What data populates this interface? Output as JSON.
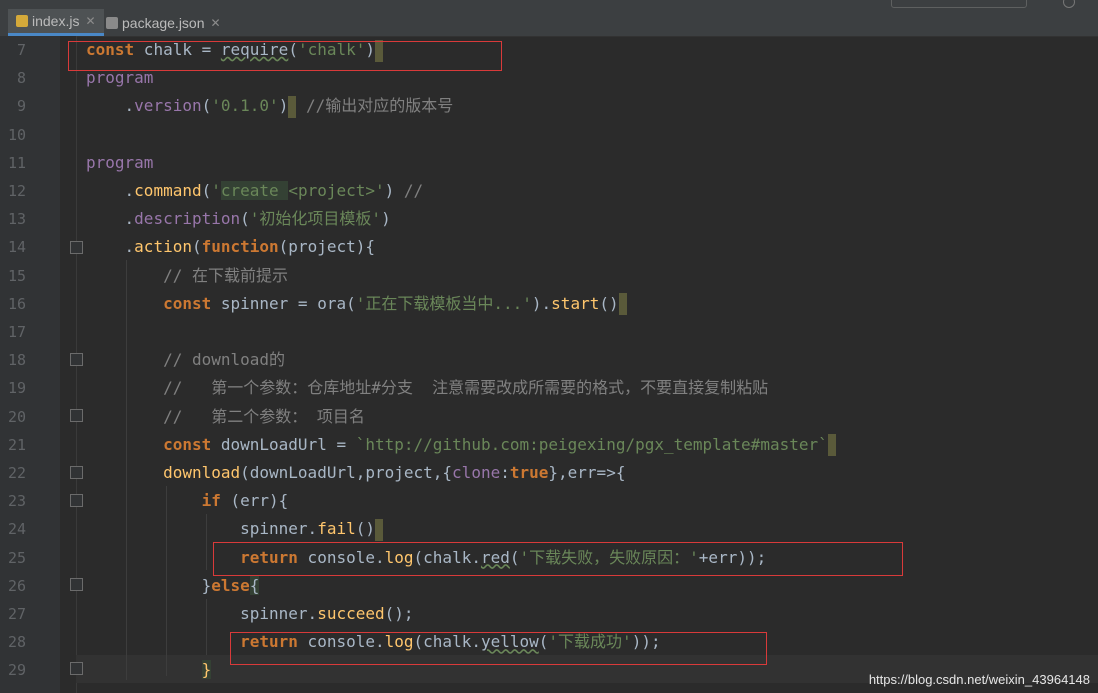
{
  "tabs": [
    {
      "label": "index.js",
      "active": true
    },
    {
      "label": "package.json",
      "active": false
    }
  ],
  "lines": [
    {
      "n": "7",
      "html": "<span class=\"kw\">const</span> chalk = <span class=\"under\">require</span>(<span class=\"str\">'chalk'</span>)<span class=\"caretbox\"></span>"
    },
    {
      "n": "8",
      "html": "<span class=\"prop\">program</span>"
    },
    {
      "n": "9",
      "html": "    .<span class=\"prop\">version</span>(<span class=\"str\">'0.1.0'</span>)<span class=\"caretbox\"></span> <span class=\"cm\">//输出对应的版本号</span>"
    },
    {
      "n": "10",
      "html": ""
    },
    {
      "n": "11",
      "html": "<span class=\"prop\">program</span>"
    },
    {
      "n": "12",
      "html": "    .<span class=\"fn\">command</span>(<span class=\"str\">'<span class=\"hl\">create </span>&lt;project&gt;'</span>) <span class=\"cm\">//</span>"
    },
    {
      "n": "13",
      "html": "    .<span class=\"prop\">description</span>(<span class=\"str\">'初始化项目模板'</span>)"
    },
    {
      "n": "14",
      "html": "    .<span class=\"fn\">action</span>(<span class=\"kw\">function</span>(project){"
    },
    {
      "n": "15",
      "html": "        <span class=\"cm\">// 在下载前提示</span>"
    },
    {
      "n": "16",
      "html": "        <span class=\"kw\">const</span> spinner = ora(<span class=\"str\">'正在下载模板当中...'</span>).<span class=\"fn\">start</span>()<span class=\"caretbox\"></span>"
    },
    {
      "n": "17",
      "html": ""
    },
    {
      "n": "18",
      "html": "        <span class=\"cm\">// download的</span>"
    },
    {
      "n": "19",
      "html": "        <span class=\"cm\">//   第一个参数：仓库地址#分支  注意需要改成所需要的格式，不要直接复制粘贴</span>"
    },
    {
      "n": "20",
      "html": "        <span class=\"cm\">//   第二个参数： 项目名</span>"
    },
    {
      "n": "21",
      "html": "        <span class=\"kw\">const</span> downLoadUrl = <span class=\"str\">`http://github.com:peigexing/pgx_template#master`</span><span class=\"caretbox\"></span>"
    },
    {
      "n": "22",
      "html": "        <span class=\"fn\">download</span>(downLoadUrl,project,{<span class=\"prop\">clone</span>:<span class=\"kw\">true</span>},err=&gt;{"
    },
    {
      "n": "23",
      "html": "            <span class=\"kw\">if</span> (err){"
    },
    {
      "n": "24",
      "html": "                spinner.<span class=\"fn\">fail</span>()<span class=\"caretbox\"></span>"
    },
    {
      "n": "25",
      "html": "                <span class=\"kw\">return</span> console.<span class=\"fn\">log</span>(chalk.<span class=\"under\">red</span>(<span class=\"str\">'下载失败，失败原因：'</span>+err));"
    },
    {
      "n": "26",
      "html": "            }<span class=\"kw\">else</span><span class=\"hl\">{</span>"
    },
    {
      "n": "27",
      "html": "                spinner.<span class=\"fn\">succeed</span>();"
    },
    {
      "n": "28",
      "html": "                <span class=\"kw\">return</span> console.<span class=\"fn\">log</span>(chalk.<span class=\"under\">yellow</span>(<span class=\"str\">'下载成功'</span>));"
    },
    {
      "n": "29",
      "html": "            <span class=\"hl\"><span class=\"fn\">}</span></span>"
    }
  ],
  "watermark": "https://blog.csdn.net/weixin_43964148",
  "colors": {
    "background": "#2b2b2b",
    "keyword": "#cc7832",
    "string": "#6a8759",
    "comment": "#808080",
    "function": "#ffc66d",
    "property": "#9876aa",
    "annotation_box": "#d93a3a"
  }
}
